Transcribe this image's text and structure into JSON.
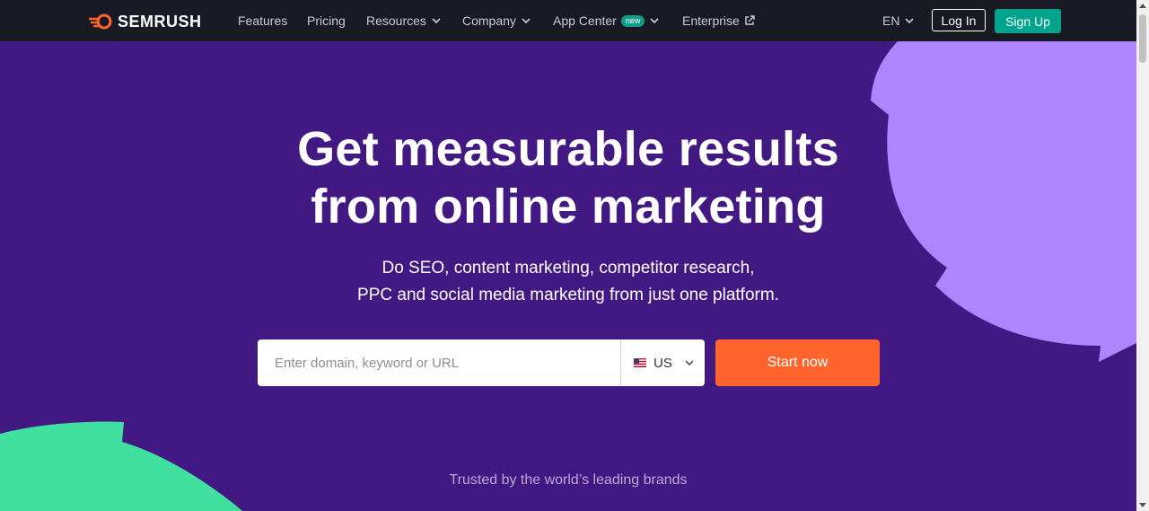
{
  "colors": {
    "background": "#421983",
    "topbar": "#171a22",
    "accent_orange": "#ff642d",
    "signup_green": "#00a38b",
    "shape_purple": "#b084ff",
    "shape_green": "#3fe0a0"
  },
  "header": {
    "logo_text": "SEMRUSH",
    "nav": [
      {
        "label": "Features"
      },
      {
        "label": "Pricing"
      },
      {
        "label": "Resources"
      },
      {
        "label": "Company"
      },
      {
        "label": "App Center",
        "badge": "new"
      },
      {
        "label": "Enterprise"
      }
    ],
    "language": "EN",
    "login_label": "Log In",
    "signup_label": "Sign Up"
  },
  "hero": {
    "title_line1": "Get measurable results",
    "title_line2": "from online marketing",
    "subtitle_line1": "Do SEO, content marketing, competitor research,",
    "subtitle_line2": "PPC and social media marketing from just one platform."
  },
  "search": {
    "placeholder": "Enter domain, keyword or URL",
    "value": "",
    "country": "US",
    "start_label": "Start now"
  },
  "trusted_label": "Trusted by the world’s leading brands"
}
